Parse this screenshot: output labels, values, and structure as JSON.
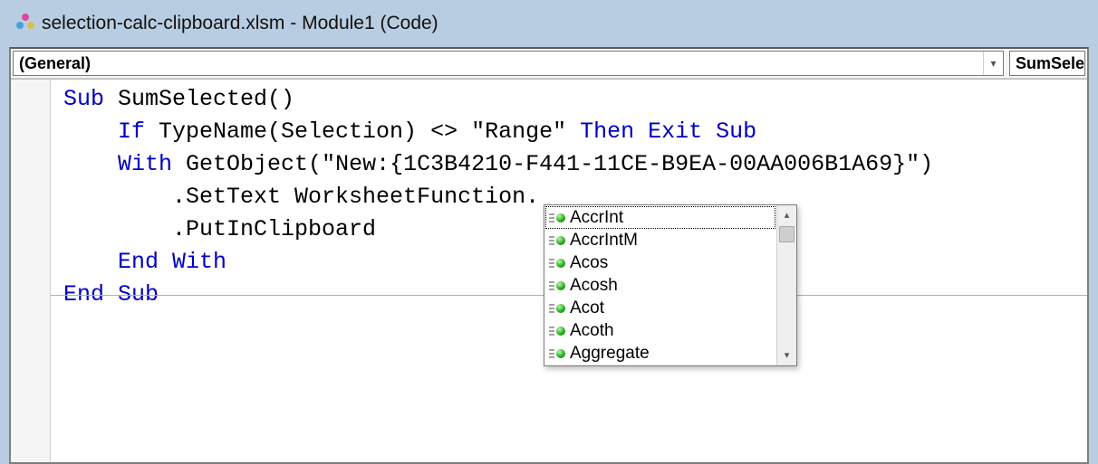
{
  "title": "selection-calc-clipboard.xlsm - Module1 (Code)",
  "dropdowns": {
    "left": "(General)",
    "right": "SumSele"
  },
  "code": {
    "l1a": "Sub",
    "l1b": " SumSelected()",
    "l2a": "    If",
    "l2b": " TypeName(Selection) <> ",
    "l2c": "\"Range\"",
    "l2d": " Then Exit Sub",
    "l3a": "    With",
    "l3b": " GetObject(",
    "l3c": "\"New:{1C3B4210-F441-11CE-B9EA-00AA006B1A69}\"",
    "l3d": ")",
    "l4": "        .SetText WorksheetFunction.",
    "l5": "        .PutInClipboard",
    "l6": "    End With",
    "l7": "End Sub"
  },
  "intellisense": {
    "selected_index": 0,
    "items": [
      "AccrInt",
      "AccrIntM",
      "Acos",
      "Acosh",
      "Acot",
      "Acoth",
      "Aggregate"
    ]
  }
}
